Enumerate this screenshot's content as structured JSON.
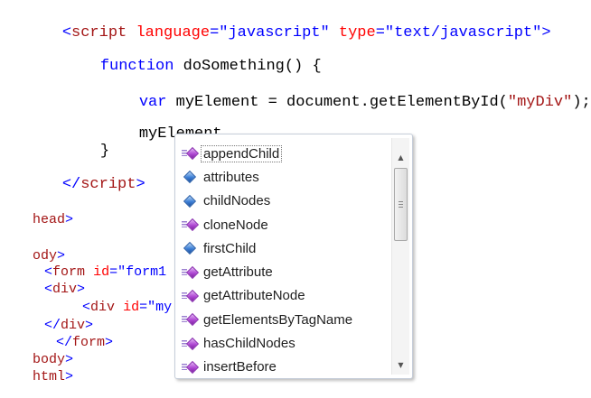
{
  "editor": {
    "line1": {
      "open": "<",
      "tag": "script",
      "attr1_name": "language",
      "eq1": "=",
      "attr1_value": "\"javascript\"",
      "attr2_name": "type",
      "eq2": "=",
      "attr2_value": "\"text/javascript\"",
      "close": ">"
    },
    "line2": {
      "keyword": "function",
      "rest": "doSomething() {"
    },
    "line3": {
      "keyword": "var",
      "rest": "myElement = document.getElementById(",
      "string": "\"myDiv\"",
      "end": ");"
    },
    "line4": {
      "text": "myElement."
    },
    "line5": {
      "text": "}"
    },
    "line6": {
      "open": "</",
      "tag": "script",
      "close": ">"
    },
    "line7": {
      "tag": "head",
      "close": ">"
    },
    "line8": {
      "tag": "ody",
      "close": ">"
    },
    "line9": {
      "open": "<",
      "tag": "form",
      "attr_name": "id",
      "eq": "=",
      "attr_value": "\"form1"
    },
    "line10": {
      "open": "<",
      "tag": "div",
      "close": ">"
    },
    "line11": {
      "open": "<",
      "tag": "div",
      "attr_name": "id",
      "eq": "=",
      "attr_value": "\"my"
    },
    "line12": {
      "open": "</",
      "tag": "div",
      "close": ">"
    },
    "line13": {
      "open": "</",
      "tag": "form",
      "close": ">"
    },
    "line14": {
      "tag": "body",
      "close": ">"
    },
    "line15": {
      "tag": "html",
      "close": ">"
    }
  },
  "intellisense": {
    "items": [
      {
        "label": "appendChild",
        "icon": "method-icon",
        "selected": true
      },
      {
        "label": "attributes",
        "icon": "property-icon"
      },
      {
        "label": "childNodes",
        "icon": "property-icon"
      },
      {
        "label": "cloneNode",
        "icon": "method-icon"
      },
      {
        "label": "firstChild",
        "icon": "property-icon"
      },
      {
        "label": "getAttribute",
        "icon": "method-icon"
      },
      {
        "label": "getAttributeNode",
        "icon": "method-icon"
      },
      {
        "label": "getElementsByTagName",
        "icon": "method-icon"
      },
      {
        "label": "hasChildNodes",
        "icon": "method-icon"
      },
      {
        "label": "insertBefore",
        "icon": "method-icon"
      }
    ],
    "scroll_up_icon": "▲",
    "scroll_down_icon": "▼"
  }
}
